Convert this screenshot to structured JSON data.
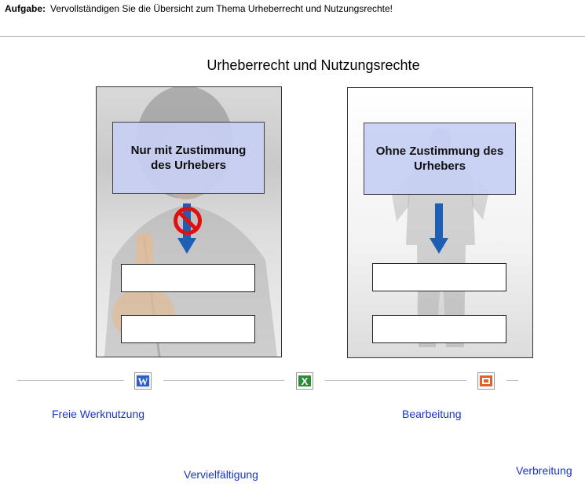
{
  "task": {
    "label": "Aufgabe:",
    "text": "Vervollständigen Sie die Übersicht zum Thema Urheberrecht und Nutzungsrechte!"
  },
  "title": "Urheberrecht und Nutzungsrechte",
  "left_panel": {
    "heading": "Nur mit Zustimmung des Urhebers"
  },
  "right_panel": {
    "heading": "Ohne Zustimmung des Urhebers"
  },
  "icons": [
    "word-icon",
    "excel-icon",
    "powerpoint-icon"
  ],
  "terms": [
    "Freie Werknutzung",
    "Bearbeitung",
    "Vervielfältigung",
    "Verbreitung"
  ],
  "colors": {
    "heading_box": "#c8d0f5",
    "arrow": "#1e5fb4",
    "term_link": "#1a33c8",
    "no_sign": "#e01010"
  }
}
